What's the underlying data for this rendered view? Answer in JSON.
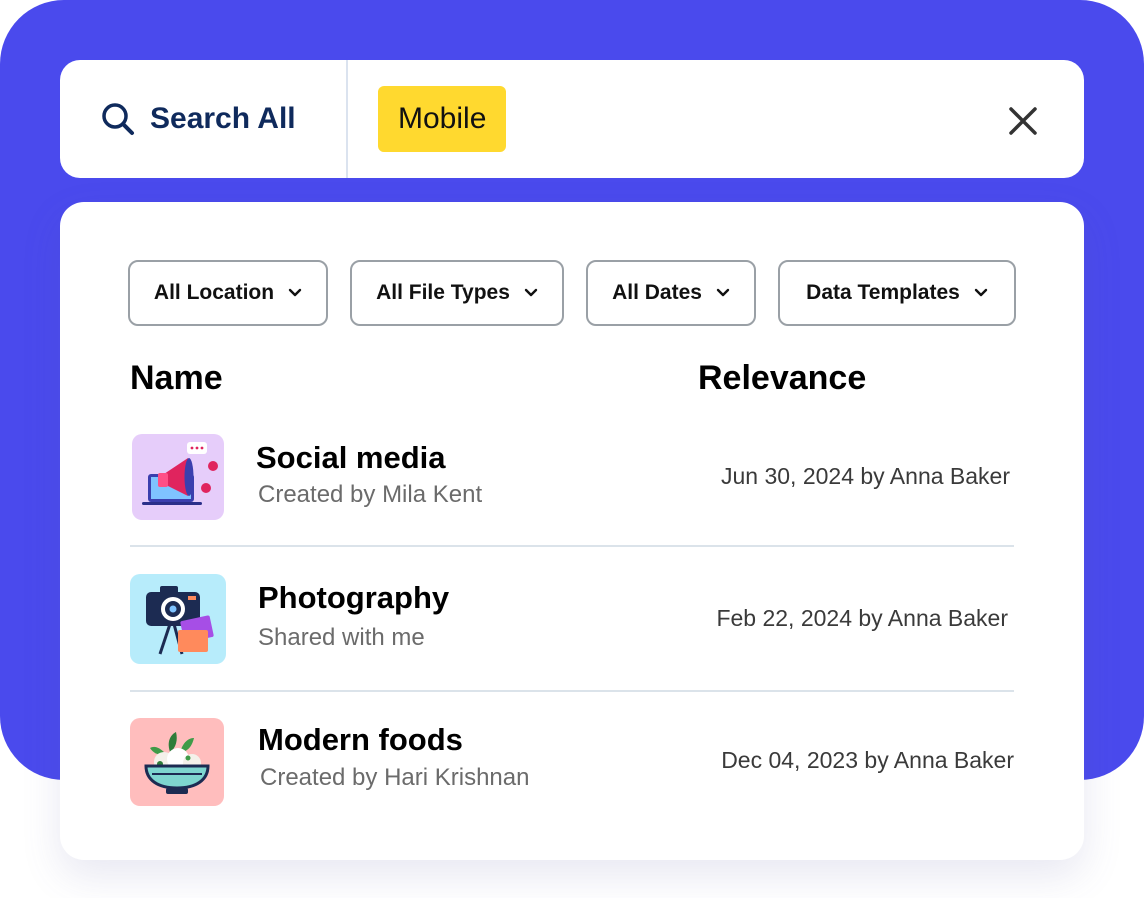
{
  "search": {
    "scope_label": "Search All",
    "chip_label": "Mobile"
  },
  "filters": [
    {
      "label": "All Location"
    },
    {
      "label": "All File Types"
    },
    {
      "label": "All Dates"
    },
    {
      "label": "Data Templates"
    }
  ],
  "columns": {
    "name": "Name",
    "relevance": "Relevance"
  },
  "results": [
    {
      "title": "Social media",
      "subtitle": "Created by Mila Kent",
      "meta": "Jun 30, 2024 by Anna Baker",
      "icon": "megaphone-laptop-icon"
    },
    {
      "title": "Photography",
      "subtitle": "Shared with me",
      "meta": "Feb 22, 2024 by Anna Baker",
      "icon": "camera-tripod-icon"
    },
    {
      "title": "Modern foods",
      "subtitle": "Created by Hari Krishnan",
      "meta": "Dec 04, 2023 by Anna Baker",
      "icon": "food-bowl-icon"
    }
  ],
  "colors": {
    "background": "#4a4aed",
    "chip": "#ffd92f",
    "search_text": "#0f2a5c"
  }
}
